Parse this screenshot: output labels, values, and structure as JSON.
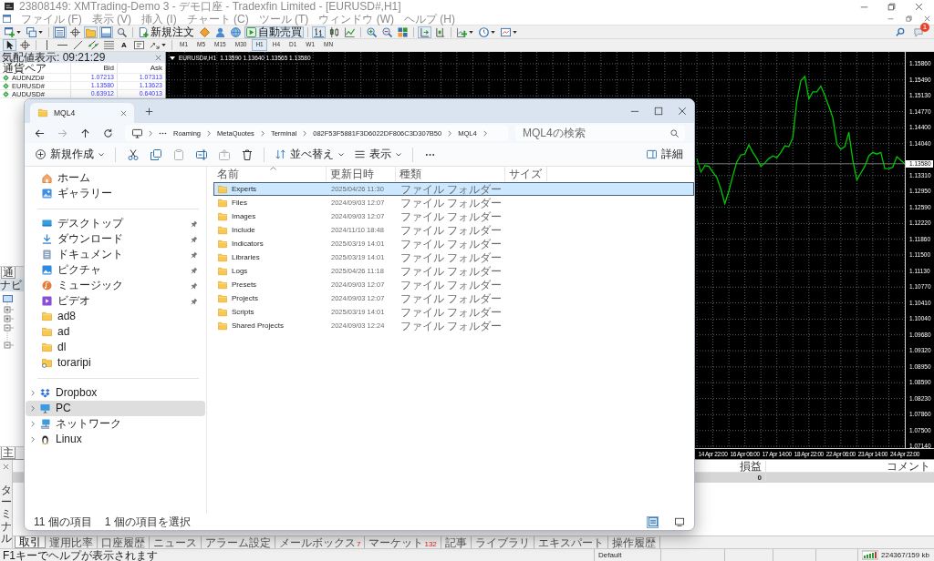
{
  "mt4": {
    "title": "23808149: XMTrading-Demo 3 - デモ口座 - Tradexfin Limited - [EURUSD#,H1]",
    "menu": [
      "ファイル (F)",
      "表示 (V)",
      "挿入 (I)",
      "チャート (C)",
      "ツール (T)",
      "ウィンドウ (W)",
      "ヘルプ (H)"
    ],
    "toolbar": [
      [
        {
          "on": false
        },
        {
          "on": false
        }
      ],
      [
        {
          "on": true
        },
        {
          "on": false
        },
        {
          "on": true
        },
        {
          "on": true
        },
        {
          "on": false
        }
      ],
      [
        {
          "label": "新規注文",
          "on": false
        },
        {
          "on": false
        },
        {
          "on": false
        },
        {
          "on": false
        },
        {
          "label": "自動売買",
          "on": true
        }
      ],
      [
        {
          "on": true
        },
        {
          "on": false
        },
        {
          "on": false
        }
      ],
      [
        {
          "on": false
        },
        {
          "on": false
        },
        {
          "on": false
        }
      ],
      [
        {
          "on": true
        },
        {
          "on": false
        }
      ],
      [
        {
          "on": false
        },
        {
          "on": false
        },
        {
          "on": false
        }
      ]
    ],
    "notification_count": "1",
    "drawing_tools": [
      [
        {
          "on": true
        },
        {
          "on": false
        }
      ],
      [
        {
          "on": false
        },
        {
          "on": false
        },
        {
          "on": false
        },
        {
          "on": false
        },
        {
          "on": false
        },
        {
          "glyph": "A",
          "on": false
        },
        {
          "on": false
        },
        {
          "on": false
        }
      ]
    ],
    "timeframes": [
      {
        "label": "M1",
        "selected": false
      },
      {
        "label": "M5",
        "selected": false
      },
      {
        "label": "M15",
        "selected": false
      },
      {
        "label": "M30",
        "selected": false
      },
      {
        "label": "H1",
        "selected": true
      },
      {
        "label": "H4",
        "selected": false
      },
      {
        "label": "D1",
        "selected": false
      },
      {
        "label": "W1",
        "selected": false
      },
      {
        "label": "MN",
        "selected": false
      }
    ],
    "market_watch": {
      "title": "気配値表示: 09:21:29",
      "columns": [
        "通貨ペア",
        "Bid",
        "Ask"
      ],
      "rows": [
        {
          "symbol": "AUDNZD#",
          "bid": "1.07213",
          "ask": "1.07313"
        },
        {
          "symbol": "EURUSD#",
          "bid": "1.13580",
          "ask": "1.13623"
        },
        {
          "symbol": "AUDUSD#",
          "bid": "0.63912",
          "ask": "0.64013"
        }
      ]
    },
    "panel_tab": "通",
    "navigator_title": "ナビ",
    "lower_tab": "主",
    "chart": {
      "symbol": "EURUSD#,H1",
      "ohlc": "1.13590 1.13640 1.13565 1.13580",
      "chart_data": {
        "type": "line",
        "grid": true,
        "categories": [
          null,
          null,
          null,
          null,
          "14 Apr 22:00",
          null,
          null,
          null,
          null,
          null,
          null,
          null,
          "16 Apr 06:00",
          null,
          null,
          null,
          null,
          null,
          null,
          null,
          "17 Apr 14:00",
          null,
          null,
          null,
          null,
          null,
          null,
          null,
          "18 Apr 22:00",
          null,
          null,
          null,
          null,
          null,
          null,
          null,
          "22 Apr 06:00",
          null,
          null,
          null,
          null,
          null,
          null,
          null,
          "23 Apr 14:00",
          null,
          null,
          null,
          null,
          null,
          null,
          null,
          "24 Apr 22:00"
        ],
        "series": [
          {
            "color": "#00c800",
            "values": [
              1.137,
              1.1339,
              1.1354,
              1.1352,
              1.1339,
              1.1327,
              1.13,
              1.1267,
              1.1296,
              1.1331,
              1.1362,
              1.1378,
              1.138,
              1.1401,
              1.1384,
              1.137,
              1.1352,
              1.136,
              1.137,
              1.1376,
              1.1372,
              1.1384,
              1.1399,
              1.1397,
              1.1417,
              1.15,
              1.1547,
              1.1557,
              1.1506,
              1.1522,
              1.1522,
              1.1535,
              1.1514,
              1.1489,
              1.1463,
              1.1403,
              1.1391,
              1.1397,
              1.143,
              1.1366,
              1.1321,
              1.1337,
              1.1352,
              1.1376,
              1.1384,
              1.138,
              1.1384,
              1.1347,
              1.1347,
              1.135,
              1.1374,
              1.1366,
              1.1358
            ]
          }
        ],
        "ylim": [
          1.071,
          1.1613
        ],
        "yticks": [
          {
            "value": 1.1586,
            "label": "1.15860"
          },
          {
            "value": 1.1549,
            "label": "1.15490"
          },
          {
            "value": 1.1513,
            "label": "1.15130"
          },
          {
            "value": 1.1477,
            "label": "1.14770"
          },
          {
            "value": 1.144,
            "label": "1.14400"
          },
          {
            "value": 1.1404,
            "label": "1.14040"
          },
          {
            "value": 1.1331,
            "label": "1.13310"
          },
          {
            "value": 1.1295,
            "label": "1.12950"
          },
          {
            "value": 1.1259,
            "label": "1.12590"
          },
          {
            "value": 1.1222,
            "label": "1.12220"
          },
          {
            "value": 1.1186,
            "label": "1.11860"
          },
          {
            "value": 1.115,
            "label": "1.11500"
          },
          {
            "value": 1.1113,
            "label": "1.11130"
          },
          {
            "value": 1.1077,
            "label": "1.10770"
          },
          {
            "value": 1.1041,
            "label": "1.10410"
          },
          {
            "value": 1.1004,
            "label": "1.10040"
          },
          {
            "value": 1.0968,
            "label": "1.09680"
          },
          {
            "value": 1.0932,
            "label": "1.09320"
          },
          {
            "value": 1.0895,
            "label": "1.08950"
          },
          {
            "value": 1.0859,
            "label": "1.08590"
          },
          {
            "value": 1.0823,
            "label": "1.08230"
          },
          {
            "value": 1.0786,
            "label": "1.07860"
          },
          {
            "value": 1.075,
            "label": "1.07500"
          },
          {
            "value": 1.0714,
            "label": "1.07140"
          }
        ],
        "ref_lines": [
          {
            "axis": "y",
            "value": 1.1358,
            "label": "1.13580"
          }
        ]
      }
    },
    "terminal": {
      "title": "ターミナル",
      "columns": [
        "損益",
        "コメント"
      ],
      "rows": [
        {
          "profit": "0"
        }
      ],
      "tabs": [
        {
          "label": "取引",
          "selected": true
        },
        {
          "label": "運用比率",
          "selected": false
        },
        {
          "label": "口座履歴",
          "selected": false
        },
        {
          "label": "ニュース",
          "selected": false
        },
        {
          "label": "アラーム設定",
          "selected": false
        },
        {
          "label": "メールボックス",
          "count": "7",
          "selected": false
        },
        {
          "label": "マーケット",
          "count": "132",
          "selected": false
        },
        {
          "label": "記事",
          "selected": false
        },
        {
          "label": "ライブラリ",
          "selected": false
        },
        {
          "label": "エキスパート",
          "selected": false
        },
        {
          "label": "操作履歴",
          "selected": false
        }
      ]
    },
    "status_bar": {
      "help": "F1キーでヘルプが表示されます",
      "profile": "Default",
      "traffic": "224367/159 kb"
    }
  },
  "explorer": {
    "tab": "MQL4",
    "nav_buttons": [
      {
        "disabled": false
      },
      {
        "disabled": true
      },
      {
        "disabled": false
      },
      {
        "disabled": false
      }
    ],
    "path": [
      "Roaming",
      "MetaQuotes",
      "Terminal",
      "082F53F5881F3D6022DF806C3D307B50",
      "MQL4"
    ],
    "search": {
      "placeholder": "MQL4の検索"
    },
    "commands": {
      "new": "新規作成",
      "tools": [
        {
          "disabled": false
        },
        {
          "disabled": false
        },
        {
          "disabled": true
        },
        {
          "disabled": false
        },
        {
          "disabled": true
        },
        {
          "disabled": false
        }
      ],
      "sort": "並べ替え",
      "view": "表示",
      "details": "詳細"
    },
    "sidebar": {
      "quick_access": [
        "ホーム",
        "ギャラリー"
      ],
      "pinned": [
        {
          "label": "デスクトップ",
          "pinned": true
        },
        {
          "label": "ダウンロード",
          "pinned": true
        },
        {
          "label": "ドキュメント",
          "pinned": true
        },
        {
          "label": "ピクチャ",
          "pinned": true
        },
        {
          "label": "ミュージック",
          "pinned": true
        },
        {
          "label": "ビデオ",
          "pinned": true
        },
        {
          "label": "ad8",
          "pinned": false
        },
        {
          "label": "ad",
          "pinned": false
        },
        {
          "label": "dl",
          "pinned": false
        },
        {
          "label": "toraripi",
          "pinned": false
        }
      ],
      "locations": [
        {
          "label": "Dropbox",
          "selected": false,
          "expanded": false
        },
        {
          "label": "PC",
          "selected": true,
          "expanded": false
        },
        {
          "label": "ネットワーク",
          "selected": false,
          "expanded": false
        },
        {
          "label": "Linux",
          "selected": false,
          "expanded": false
        }
      ]
    },
    "columns": [
      "名前",
      "更新日時",
      "種類",
      "サイズ"
    ],
    "files": [
      {
        "name": "Experts",
        "modified": "2025/04/26 11:30",
        "type": "ファイル フォルダー",
        "selected": true
      },
      {
        "name": "Files",
        "modified": "2024/09/03 12:07",
        "type": "ファイル フォルダー",
        "selected": false
      },
      {
        "name": "Images",
        "modified": "2024/09/03 12:07",
        "type": "ファイル フォルダー",
        "selected": false
      },
      {
        "name": "Include",
        "modified": "2024/11/10 18:48",
        "type": "ファイル フォルダー",
        "selected": false
      },
      {
        "name": "Indicators",
        "modified": "2025/03/19 14:01",
        "type": "ファイル フォルダー",
        "selected": false
      },
      {
        "name": "Libraries",
        "modified": "2025/03/19 14:01",
        "type": "ファイル フォルダー",
        "selected": false
      },
      {
        "name": "Logs",
        "modified": "2025/04/26 11:18",
        "type": "ファイル フォルダー",
        "selected": false
      },
      {
        "name": "Presets",
        "modified": "2024/09/03 12:07",
        "type": "ファイル フォルダー",
        "selected": false
      },
      {
        "name": "Projects",
        "modified": "2024/09/03 12:07",
        "type": "ファイル フォルダー",
        "selected": false
      },
      {
        "name": "Scripts",
        "modified": "2025/03/19 14:01",
        "type": "ファイル フォルダー",
        "selected": false
      },
      {
        "name": "Shared Projects",
        "modified": "2024/09/03 12:24",
        "type": "ファイル フォルダー",
        "selected": false
      }
    ],
    "status": {
      "count": "11 個の項目",
      "selection": "1 個の項目を選択"
    },
    "view_modes": [
      {
        "selected": true
      },
      {
        "selected": false
      }
    ]
  }
}
